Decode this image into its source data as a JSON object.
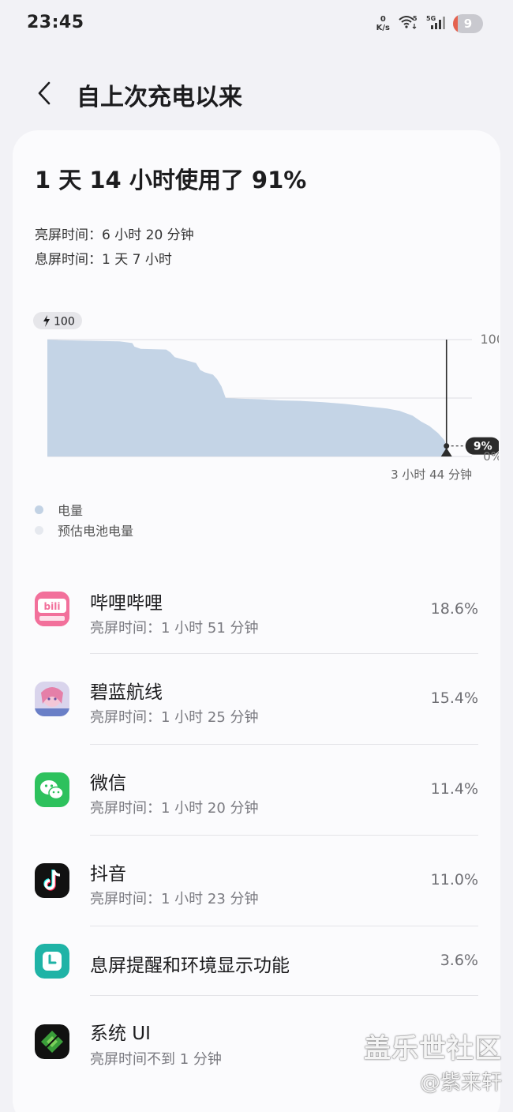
{
  "status_bar": {
    "time": "23:45",
    "net_speed_value": "0",
    "net_speed_unit": "K/s",
    "wifi_label": "5",
    "cell_label": "5G",
    "battery_level": "9",
    "icons": [
      "wifi-icon",
      "cellular-signal-icon",
      "battery-icon"
    ]
  },
  "header": {
    "title": "自上次充电以来",
    "back_icon": "chevron-left-icon"
  },
  "summary": {
    "headline": "1 天 14 小时使用了 91%",
    "screen_on": "亮屏时间：6 小时 20 分钟",
    "screen_off": "息屏时间：1 天 7 小时"
  },
  "chart_data": {
    "type": "area",
    "start_label": "100",
    "start_icon": "bolt-icon",
    "y_tick_top": "100",
    "y_tick_bottom": "0%",
    "current_value_label": "9%",
    "current_value": 9,
    "time_remaining_label": "3 小时 44 分钟",
    "ylim": [
      0,
      100
    ],
    "x_fraction": [
      0,
      0.03,
      0.1,
      0.17,
      0.2,
      0.205,
      0.22,
      0.28,
      0.29,
      0.3,
      0.35,
      0.36,
      0.37,
      0.39,
      0.4,
      0.41,
      0.42,
      0.45,
      0.5,
      0.55,
      0.6,
      0.65,
      0.7,
      0.75,
      0.8,
      0.83,
      0.86,
      0.88,
      0.9,
      0.92,
      0.935,
      0.94
    ],
    "battery_percent": [
      100,
      99.5,
      99,
      98.5,
      97,
      94,
      92,
      91.5,
      89,
      85,
      80,
      74,
      72,
      70,
      66,
      60,
      50,
      49.5,
      49,
      48,
      47.5,
      46.5,
      45,
      43,
      41,
      39,
      35,
      30,
      26,
      20,
      14,
      9
    ],
    "grid": true,
    "legend": [
      {
        "label": "电量",
        "color": "#c2d2e4"
      },
      {
        "label": "预估电池电量",
        "color": "#e6e9ef"
      }
    ],
    "colors": {
      "area": "#c4d4e6",
      "marker": "#2b2b2b",
      "grid": "#dddde2"
    }
  },
  "apps": [
    {
      "name": "哔哩哔哩",
      "detail": "亮屏时间：1 小时 51 分钟",
      "percent": "18.6%",
      "icon": "bilibili-icon"
    },
    {
      "name": "碧蓝航线",
      "detail": "亮屏时间：1 小时 25 分钟",
      "percent": "15.4%",
      "icon": "azur-lane-icon"
    },
    {
      "name": "微信",
      "detail": "亮屏时间：1 小时 20 分钟",
      "percent": "11.4%",
      "icon": "wechat-icon"
    },
    {
      "name": "抖音",
      "detail": "亮屏时间：1 小时 23 分钟",
      "percent": "11.0%",
      "icon": "douyin-icon"
    },
    {
      "name": "息屏提醒和环境显示功能",
      "detail": "",
      "percent": "3.6%",
      "icon": "always-on-display-icon"
    },
    {
      "name": "系统 UI",
      "detail": "亮屏时间不到 1 分钟",
      "percent": "",
      "icon": "system-ui-icon"
    }
  ],
  "watermark": {
    "line1": "盖乐世社区",
    "line2": "@紫来轩"
  }
}
